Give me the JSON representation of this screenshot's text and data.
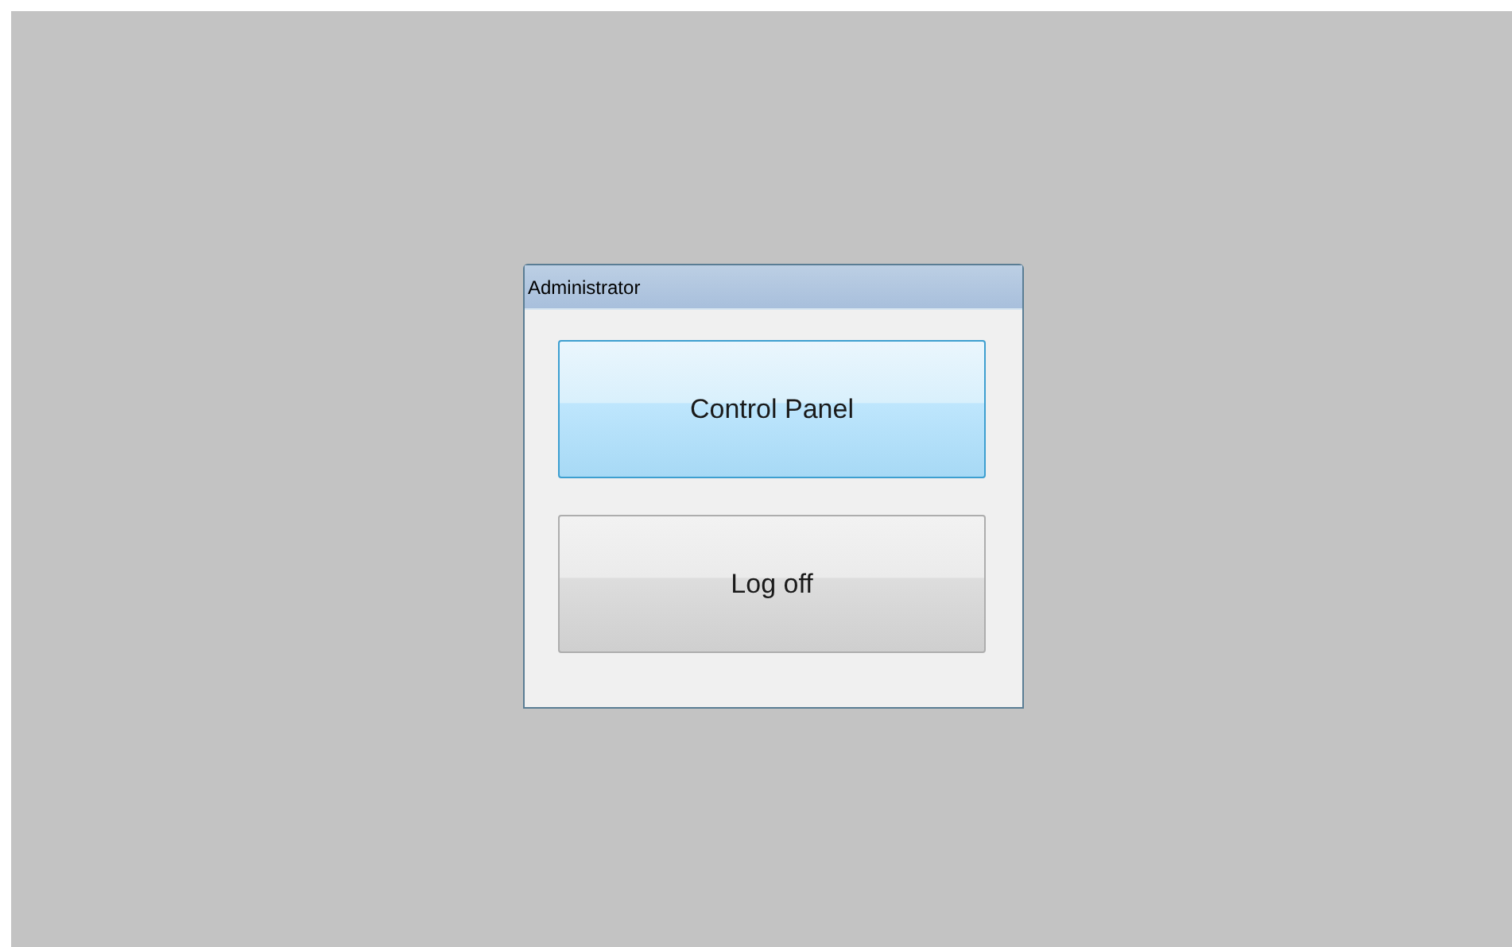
{
  "dialog": {
    "title": "Administrator"
  },
  "buttons": [
    {
      "label": "Control Panel",
      "highlighted": true
    },
    {
      "label": "Log off",
      "highlighted": false
    }
  ]
}
